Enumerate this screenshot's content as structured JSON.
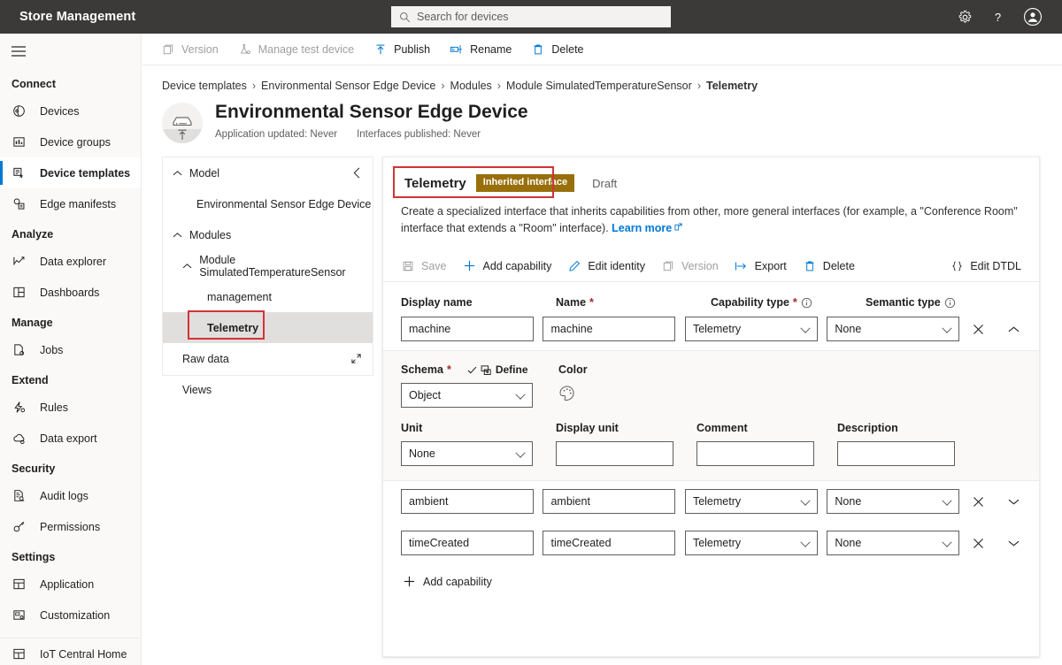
{
  "topbar": {
    "title": "Store Management",
    "search_placeholder": "Search for devices",
    "icons": [
      "gear-icon",
      "help-icon",
      "account-icon"
    ]
  },
  "sidebar": {
    "groups": [
      {
        "label": "Connect",
        "items": [
          {
            "label": "Devices",
            "icon": "devices-icon",
            "active": false
          },
          {
            "label": "Device groups",
            "icon": "device-groups-icon",
            "active": false
          },
          {
            "label": "Device templates",
            "icon": "device-templates-icon",
            "active": true
          },
          {
            "label": "Edge manifests",
            "icon": "edge-manifests-icon",
            "active": false
          }
        ]
      },
      {
        "label": "Analyze",
        "items": [
          {
            "label": "Data explorer",
            "icon": "data-explorer-icon",
            "active": false
          },
          {
            "label": "Dashboards",
            "icon": "dashboards-icon",
            "active": false
          }
        ]
      },
      {
        "label": "Manage",
        "items": [
          {
            "label": "Jobs",
            "icon": "jobs-icon",
            "active": false
          }
        ]
      },
      {
        "label": "Extend",
        "items": [
          {
            "label": "Rules",
            "icon": "rules-icon",
            "active": false
          },
          {
            "label": "Data export",
            "icon": "data-export-icon",
            "active": false
          }
        ]
      },
      {
        "label": "Security",
        "items": [
          {
            "label": "Audit logs",
            "icon": "audit-logs-icon",
            "active": false
          },
          {
            "label": "Permissions",
            "icon": "permissions-icon",
            "active": false
          }
        ]
      },
      {
        "label": "Settings",
        "items": [
          {
            "label": "Application",
            "icon": "application-icon",
            "active": false
          },
          {
            "label": "Customization",
            "icon": "customization-icon",
            "active": false
          }
        ]
      }
    ],
    "footer_item": {
      "label": "IoT Central Home",
      "icon": "home-icon"
    }
  },
  "commandbar": [
    {
      "label": "Version",
      "icon": "version-icon",
      "disabled": true
    },
    {
      "label": "Manage test device",
      "icon": "test-device-icon",
      "disabled": true
    },
    {
      "label": "Publish",
      "icon": "publish-icon",
      "disabled": false
    },
    {
      "label": "Rename",
      "icon": "rename-icon",
      "disabled": false
    },
    {
      "label": "Delete",
      "icon": "delete-icon",
      "disabled": false
    }
  ],
  "breadcrumb": [
    "Device templates",
    "Environmental Sensor Edge Device",
    "Modules",
    "Module SimulatedTemperatureSensor",
    "Telemetry"
  ],
  "page": {
    "title": "Environmental Sensor Edge Device",
    "meta_app_updated": "Application updated: Never",
    "meta_interfaces_published": "Interfaces published: Never"
  },
  "tree": {
    "nodes": [
      {
        "label": "Model",
        "level": "lvl1",
        "chevron": "chevron-up",
        "selected": false
      },
      {
        "label": "Environmental Sensor Edge Device",
        "level": "leaf1",
        "chevron": "",
        "selected": false
      },
      {
        "label": "Modules",
        "level": "lvl1",
        "chevron": "chevron-up",
        "selected": false
      },
      {
        "label": "Module SimulatedTemperatureSensor",
        "level": "lvl2",
        "chevron": "chevron-up",
        "selected": false
      },
      {
        "label": "management",
        "level": "leaf2",
        "chevron": "",
        "selected": false
      },
      {
        "label": "Telemetry",
        "level": "leaf2",
        "chevron": "",
        "selected": true
      },
      {
        "label": "Raw data",
        "level": "leafroot",
        "chevron": "",
        "selected": false
      },
      {
        "label": "Views",
        "level": "leafroot",
        "chevron": "",
        "selected": false
      }
    ]
  },
  "card": {
    "tab_title": "Telemetry",
    "badge": "Inherited interface",
    "draft_label": "Draft",
    "description": "Create a specialized interface that inherits capabilities from other, more general interfaces (for example, a \"Conference Room\" interface that extends a \"Room\" interface). ",
    "learn_more": "Learn more",
    "toolbar": [
      {
        "label": "Save",
        "icon": "save-icon",
        "disabled": true
      },
      {
        "label": "Add capability",
        "icon": "add-icon",
        "disabled": false
      },
      {
        "label": "Edit identity",
        "icon": "edit-icon",
        "disabled": false
      },
      {
        "label": "Version",
        "icon": "version-icon",
        "disabled": true
      },
      {
        "label": "Export",
        "icon": "export-icon",
        "disabled": false
      },
      {
        "label": "Delete",
        "icon": "delete-icon",
        "disabled": false
      }
    ],
    "edit_dtdl": "Edit DTDL",
    "columns": {
      "display_name": "Display name",
      "name": "Name",
      "capability_type": "Capability type",
      "semantic_type": "Semantic type",
      "required_marker": "*"
    },
    "capabilities": [
      {
        "display_name": "machine",
        "name": "machine",
        "capability_type": "Telemetry",
        "semantic_type": "None",
        "expanded": true,
        "details": {
          "schema_label": "Schema",
          "define_label": "Define",
          "schema_value": "Object",
          "color_label": "Color",
          "unit_label": "Unit",
          "unit_value": "None",
          "display_unit_label": "Display unit",
          "display_unit_value": "",
          "comment_label": "Comment",
          "comment_value": "",
          "description_label": "Description",
          "description_value": ""
        }
      },
      {
        "display_name": "ambient",
        "name": "ambient",
        "capability_type": "Telemetry",
        "semantic_type": "None",
        "expanded": false
      },
      {
        "display_name": "timeCreated",
        "name": "timeCreated",
        "capability_type": "Telemetry",
        "semantic_type": "None",
        "expanded": false
      }
    ],
    "add_capability": "Add capability"
  },
  "colors": {
    "accent": "#0078d4",
    "badge": "#986f0b",
    "topbar": "#3b3a39",
    "annotation": "#d13438",
    "required": "#a4262c"
  }
}
